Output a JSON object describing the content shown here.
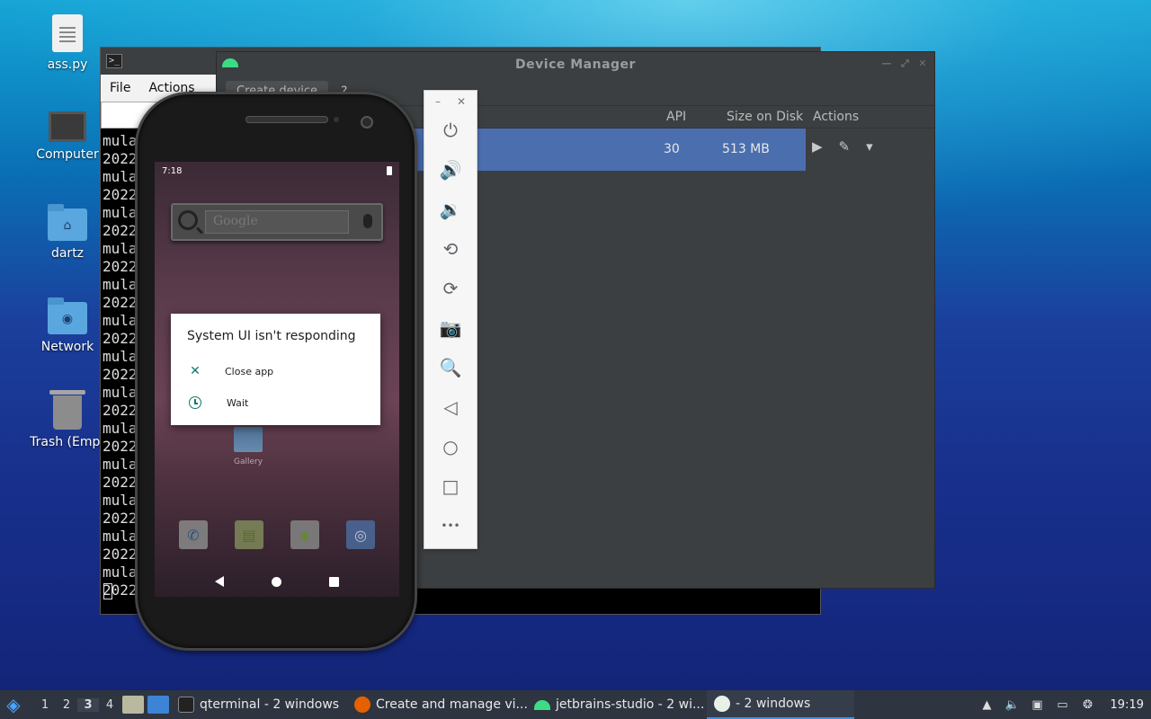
{
  "desktop": {
    "icons": [
      {
        "label": "ass.py",
        "icon": "text-file-icon"
      },
      {
        "label": "Computer",
        "icon": "computer-icon"
      },
      {
        "label": "dartz",
        "icon": "home-folder-icon"
      },
      {
        "label": "Network",
        "icon": "network-folder-icon"
      },
      {
        "label": "Trash (Empt",
        "icon": "trash-icon"
      }
    ]
  },
  "terminal": {
    "menu": [
      "File",
      "Actions"
    ],
    "lines": [
      "mula",
      "2022",
      "mula",
      "2022",
      "mula",
      "2022",
      "mula",
      "2022",
      "mula",
      "2022",
      "mula",
      "2022",
      "mula",
      "2022",
      "mula",
      "2022",
      "mula",
      "2022",
      "mula",
      "2022",
      "mula",
      "2022",
      "mula",
      "2022",
      "mula",
      "2022"
    ]
  },
  "device_manager": {
    "title": "Device Manager",
    "create_button": "Create device",
    "help": "?",
    "columns": {
      "api": "API",
      "size": "Size on Disk",
      "actions": "Actions"
    },
    "rows": [
      {
        "api": "30",
        "size": "513 MB"
      }
    ],
    "accent_color": "#4b6eaf"
  },
  "emulator_toolbar": {
    "tools": [
      {
        "name": "power-icon",
        "glyph": "⏻"
      },
      {
        "name": "volume-up-icon",
        "glyph": "🔊"
      },
      {
        "name": "volume-down-icon",
        "glyph": "🔉"
      },
      {
        "name": "rotate-left-icon",
        "glyph": "⟲"
      },
      {
        "name": "rotate-right-icon",
        "glyph": "⟳"
      },
      {
        "name": "camera-icon",
        "glyph": "📷"
      },
      {
        "name": "zoom-icon",
        "glyph": "🔍"
      },
      {
        "name": "back-icon",
        "glyph": "◁"
      },
      {
        "name": "home-icon",
        "glyph": "○"
      },
      {
        "name": "overview-icon",
        "glyph": "□"
      },
      {
        "name": "more-icon",
        "glyph": "•••"
      }
    ]
  },
  "phone": {
    "status_time": "7:18",
    "search_placeholder": "Google",
    "gallery_label": "Gallery",
    "dialog": {
      "title": "System UI isn't responding",
      "close_label": "Close app",
      "wait_label": "Wait",
      "accent_color": "#0f7a6d"
    }
  },
  "taskbar": {
    "workspaces": [
      "1",
      "2",
      "3",
      "4"
    ],
    "active_workspace": "3",
    "tasks": [
      {
        "label": "qterminal - 2 windows",
        "icon": "terminal-icon"
      },
      {
        "label": "Create and manage vi...",
        "icon": "firefox-icon"
      },
      {
        "label": "jetbrains-studio - 2 wi...",
        "icon": "android-studio-icon"
      },
      {
        "label": "- 2 windows",
        "icon": "emulator-icon"
      }
    ],
    "clock": "19:19"
  }
}
